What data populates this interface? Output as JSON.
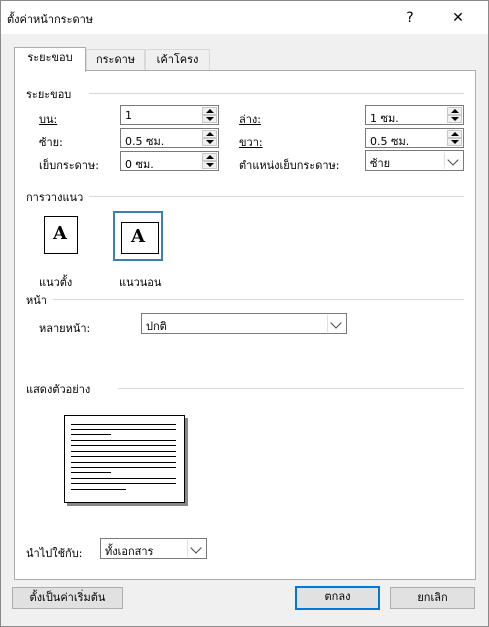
{
  "window": {
    "title": "ตั้งค่าหน้ากระดาษ",
    "help_label": "?",
    "close_label": "✕"
  },
  "tabs": [
    {
      "label": "ระยะขอบ",
      "active": true
    },
    {
      "label": "กระดาษ",
      "active": false
    },
    {
      "label": "เค้าโครง",
      "active": false
    }
  ],
  "margins": {
    "group_label": "ระยะขอบ",
    "top": {
      "label": "บน:",
      "value": "1"
    },
    "bottom": {
      "label": "ล่าง:",
      "value": "1 ซม."
    },
    "left": {
      "label": "ซ้าย:",
      "value": "0.5 ซม."
    },
    "right": {
      "label": "ขวา:",
      "value": "0.5 ซม."
    },
    "gutter": {
      "label": "เย็บกระดาษ:",
      "value": "0 ซม."
    },
    "gutter_position": {
      "label": "ตำแหน่งเย็บกระดาษ:",
      "value": "ซ้าย"
    }
  },
  "orientation": {
    "group_label": "การวางแนว",
    "portrait_label": "แนวตั้ง",
    "landscape_label": "แนวนอน",
    "icon_letter": "A",
    "selected": "landscape"
  },
  "pages": {
    "group_label": "หน้า",
    "multiple_label": "หลายหน้า:",
    "multiple_value": "ปกติ"
  },
  "preview": {
    "group_label": "แสดงตัวอย่าง"
  },
  "apply_to": {
    "label": "นำไปใช้กับ:",
    "value": "ทั้งเอกสาร"
  },
  "buttons": {
    "set_default": "ตั้งเป็นค่าเริ่มต้น",
    "ok": "ตกลง",
    "cancel": "ยกเลิก"
  }
}
